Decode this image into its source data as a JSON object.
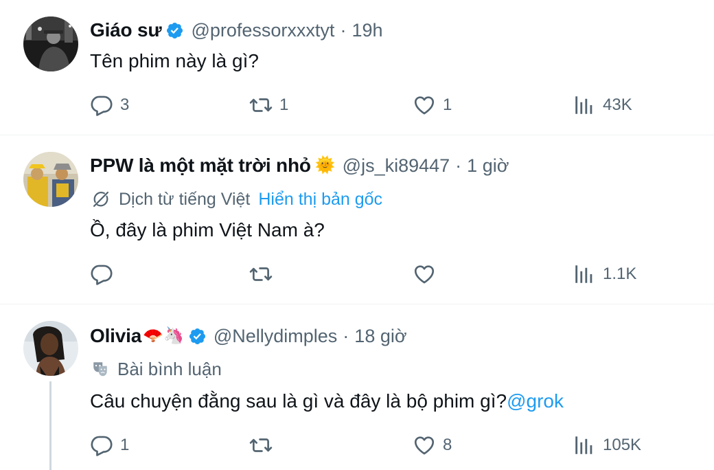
{
  "colors": {
    "accent": "#1d9bf0",
    "muted": "#536471",
    "text": "#0f1419",
    "divider": "#eff3f4",
    "thread_line": "#cfd9de"
  },
  "tweets": [
    {
      "name": "Giáo sư",
      "verified": true,
      "handle": "@professorxxxtyt",
      "separator": "·",
      "time": "19h",
      "text": "Tên phim này là gì?",
      "avatar_icon": "avatar-photo",
      "actions": {
        "replies": "3",
        "reposts": "1",
        "likes": "1",
        "views": "43K"
      }
    },
    {
      "name": "PPW là một mặt trời nhỏ",
      "name_emoji": "🌞",
      "verified": false,
      "handle": "@js_ki89447",
      "separator": "·",
      "time": "1 giờ",
      "translation": {
        "label": "Dịch từ tiếng Việt",
        "link": "Hiển thị bản gốc",
        "icon": "translate-icon"
      },
      "text": "Ồ, đây là phim Việt Nam à?",
      "avatar_icon": "avatar-photo",
      "actions": {
        "replies": "",
        "reposts": "",
        "likes": "",
        "views": "1.1K"
      }
    },
    {
      "name": "Olivia",
      "name_emoji": "🪭🦄",
      "verified": true,
      "handle": "@Nellydimples",
      "separator": "·",
      "time": "18 giờ",
      "community_note": {
        "label": "Bài bình luận",
        "icon": "masks-icon"
      },
      "text": "Câu chuyện đằng sau là gì và đây là bộ phim gì?",
      "mention": "@grok",
      "avatar_icon": "avatar-photo",
      "actions": {
        "replies": "1",
        "reposts": "",
        "likes": "8",
        "views": "105K"
      }
    }
  ]
}
